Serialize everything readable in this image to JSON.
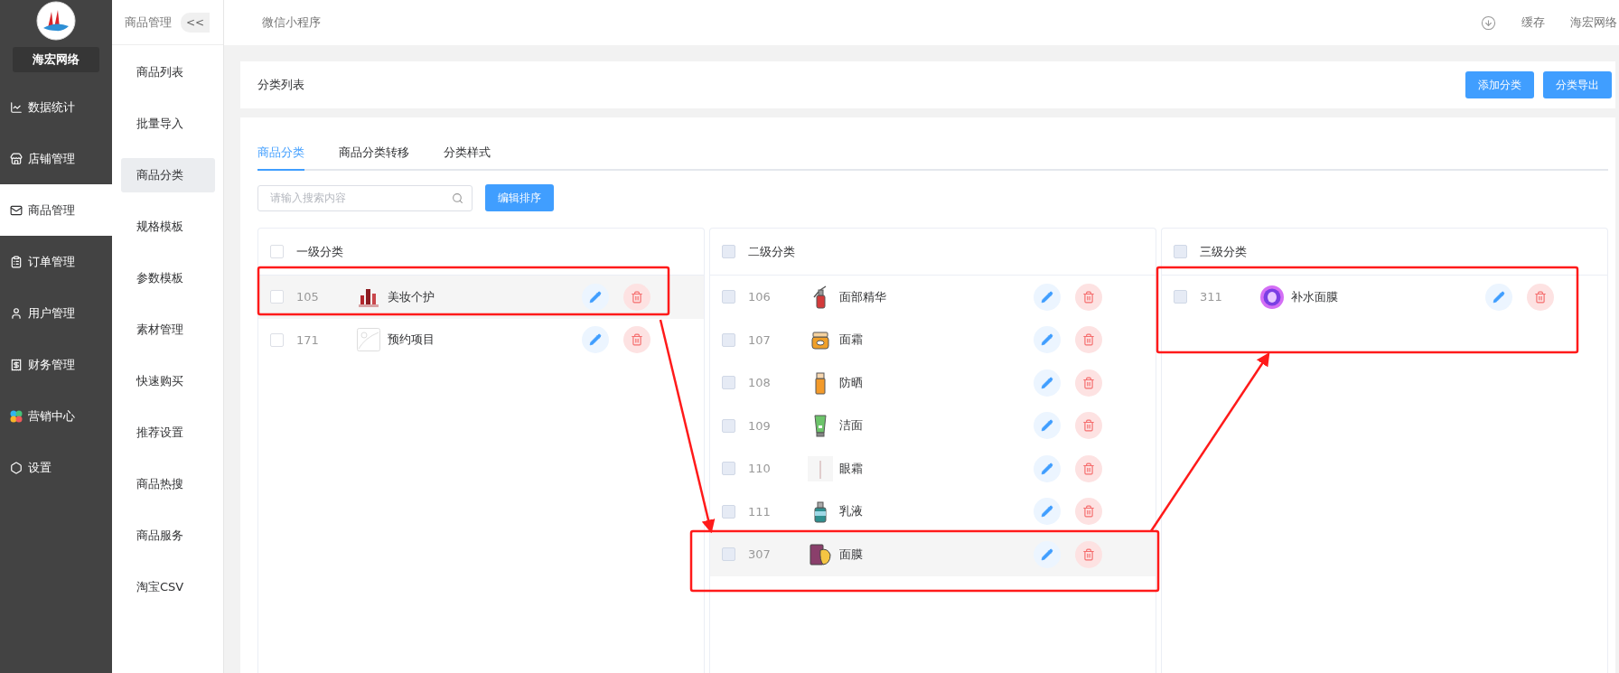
{
  "sidebar": {
    "brand": "海宏网络",
    "items": [
      {
        "label": "数据统计",
        "selected": false
      },
      {
        "label": "店铺管理",
        "selected": false
      },
      {
        "label": "商品管理",
        "selected": true
      },
      {
        "label": "订单管理",
        "selected": false
      },
      {
        "label": "用户管理",
        "selected": false
      },
      {
        "label": "财务管理",
        "selected": false
      },
      {
        "label": "营销中心",
        "selected": false
      },
      {
        "label": "设置",
        "selected": false
      }
    ]
  },
  "submenu": {
    "title": "商品管理",
    "collapse": "<<",
    "items": [
      {
        "label": "商品列表",
        "selected": false
      },
      {
        "label": "批量导入",
        "selected": false
      },
      {
        "label": "商品分类",
        "selected": true
      },
      {
        "label": "规格模板",
        "selected": false
      },
      {
        "label": "参数模板",
        "selected": false
      },
      {
        "label": "素材管理",
        "selected": false
      },
      {
        "label": "快速购买",
        "selected": false
      },
      {
        "label": "推荐设置",
        "selected": false
      },
      {
        "label": "商品热搜",
        "selected": false
      },
      {
        "label": "商品服务",
        "selected": false
      },
      {
        "label": "淘宝CSV",
        "selected": false
      }
    ]
  },
  "topbar": {
    "title": "微信小程序",
    "links": [
      "缓存",
      "海宏网络"
    ]
  },
  "header": {
    "title": "分类列表",
    "buttons": [
      "添加分类",
      "分类导出"
    ]
  },
  "tabs": [
    {
      "label": "商品分类",
      "selected": true
    },
    {
      "label": "商品分类转移",
      "selected": false
    },
    {
      "label": "分类样式",
      "selected": false
    }
  ],
  "search": {
    "placeholder": "请输入搜索内容"
  },
  "sort_button": "编辑排序",
  "columns": [
    {
      "title": "一级分类",
      "checked": false,
      "disabled": false,
      "rows": [
        {
          "id": "105",
          "name": "美妆个护",
          "checked": false,
          "selected": true
        },
        {
          "id": "171",
          "name": "预约项目",
          "checked": false,
          "selected": false
        }
      ]
    },
    {
      "title": "二级分类",
      "checked": false,
      "disabled": true,
      "rows": [
        {
          "id": "106",
          "name": "面部精华",
          "checked": false,
          "selected": false
        },
        {
          "id": "107",
          "name": "面霜",
          "checked": false,
          "selected": false
        },
        {
          "id": "108",
          "name": "防晒",
          "checked": false,
          "selected": false
        },
        {
          "id": "109",
          "name": "洁面",
          "checked": false,
          "selected": false
        },
        {
          "id": "110",
          "name": "眼霜",
          "checked": false,
          "selected": false
        },
        {
          "id": "111",
          "name": "乳液",
          "checked": false,
          "selected": false
        },
        {
          "id": "307",
          "name": "面膜",
          "checked": false,
          "selected": true
        }
      ]
    },
    {
      "title": "三级分类",
      "checked": false,
      "disabled": true,
      "rows": [
        {
          "id": "311",
          "name": "补水面膜",
          "checked": false,
          "selected": false
        }
      ]
    }
  ]
}
